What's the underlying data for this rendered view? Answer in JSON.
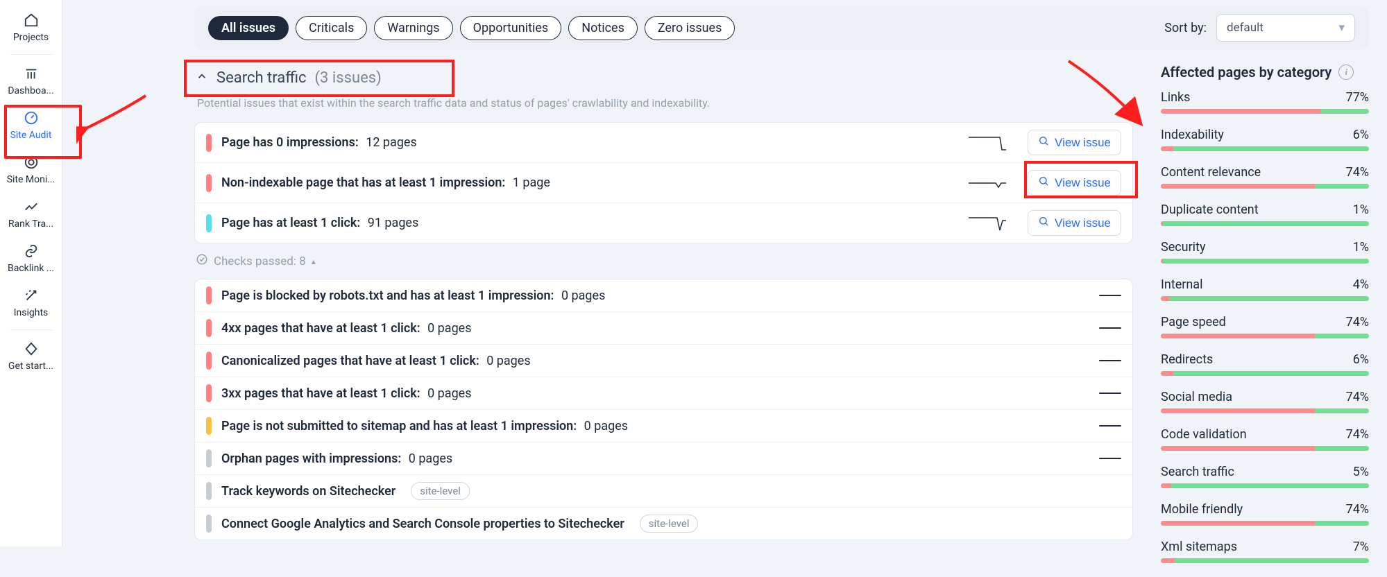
{
  "sidebar": {
    "items": [
      {
        "label": "Projects"
      },
      {
        "label": "Dashboa..."
      },
      {
        "label": "Site Audit"
      },
      {
        "label": "Site Moni..."
      },
      {
        "label": "Rank Tra..."
      },
      {
        "label": "Backlink ..."
      },
      {
        "label": "Insights"
      },
      {
        "label": "Get start..."
      }
    ]
  },
  "filters": {
    "items": [
      "All issues",
      "Criticals",
      "Warnings",
      "Opportunities",
      "Notices",
      "Zero issues"
    ],
    "sort_label": "Sort by:",
    "sort_value": "default"
  },
  "section": {
    "title": "Search traffic",
    "count": "(3 issues)",
    "desc": "Potential issues that exist within the search traffic data and status of pages' crawlability and indexability."
  },
  "view_label": "View issue",
  "issues": [
    {
      "sev": "red",
      "title": "Page has 0 impressions:",
      "sub": "12 pages"
    },
    {
      "sev": "red",
      "title": "Non-indexable page that has at least 1 impression:",
      "sub": "1 page"
    },
    {
      "sev": "cyan",
      "title": "Page has at least 1 click:",
      "sub": "91 pages"
    }
  ],
  "checks_passed": "Checks passed: 8",
  "zero_issues": [
    {
      "sev": "red",
      "title": "Page is blocked by robots.txt and has at least 1 impression:",
      "sub": "0 pages"
    },
    {
      "sev": "red",
      "title": "4xx pages that have at least 1 click:",
      "sub": "0 pages"
    },
    {
      "sev": "red",
      "title": "Canonicalized pages that have at least 1 click:",
      "sub": "0 pages"
    },
    {
      "sev": "red",
      "title": "3xx pages that have at least 1 click:",
      "sub": "0 pages"
    },
    {
      "sev": "amber",
      "title": "Page is not submitted to sitemap and has at least 1 impression:",
      "sub": "0 pages"
    },
    {
      "sev": "gray",
      "title": "Orphan pages with impressions:",
      "sub": "0 pages"
    },
    {
      "sev": "gray",
      "title": "Track keywords on Sitechecker",
      "badge": "site-level"
    },
    {
      "sev": "gray",
      "title": "Connect Google Analytics and Search Console properties to Sitechecker",
      "badge": "site-level"
    }
  ],
  "right": {
    "title": "Affected pages by category",
    "cats": [
      {
        "name": "Links",
        "pct": "77%",
        "val": 77
      },
      {
        "name": "Indexability",
        "pct": "6%",
        "val": 6
      },
      {
        "name": "Content relevance",
        "pct": "74%",
        "val": 74
      },
      {
        "name": "Duplicate content",
        "pct": "1%",
        "val": 1
      },
      {
        "name": "Security",
        "pct": "1%",
        "val": 1
      },
      {
        "name": "Internal",
        "pct": "4%",
        "val": 4
      },
      {
        "name": "Page speed",
        "pct": "74%",
        "val": 74
      },
      {
        "name": "Redirects",
        "pct": "6%",
        "val": 6
      },
      {
        "name": "Social media",
        "pct": "74%",
        "val": 74
      },
      {
        "name": "Code validation",
        "pct": "74%",
        "val": 74
      },
      {
        "name": "Search traffic",
        "pct": "5%",
        "val": 5
      },
      {
        "name": "Mobile friendly",
        "pct": "74%",
        "val": 74
      },
      {
        "name": "Xml sitemaps",
        "pct": "7%",
        "val": 7
      }
    ]
  },
  "chart_data": {
    "type": "bar",
    "title": "Affected pages by category",
    "categories": [
      "Links",
      "Indexability",
      "Content relevance",
      "Duplicate content",
      "Security",
      "Internal",
      "Page speed",
      "Redirects",
      "Social media",
      "Code validation",
      "Search traffic",
      "Mobile friendly",
      "Xml sitemaps"
    ],
    "values": [
      77,
      6,
      74,
      1,
      1,
      4,
      74,
      6,
      74,
      74,
      5,
      74,
      7
    ],
    "ylabel": "%",
    "ylim": [
      0,
      100
    ]
  }
}
